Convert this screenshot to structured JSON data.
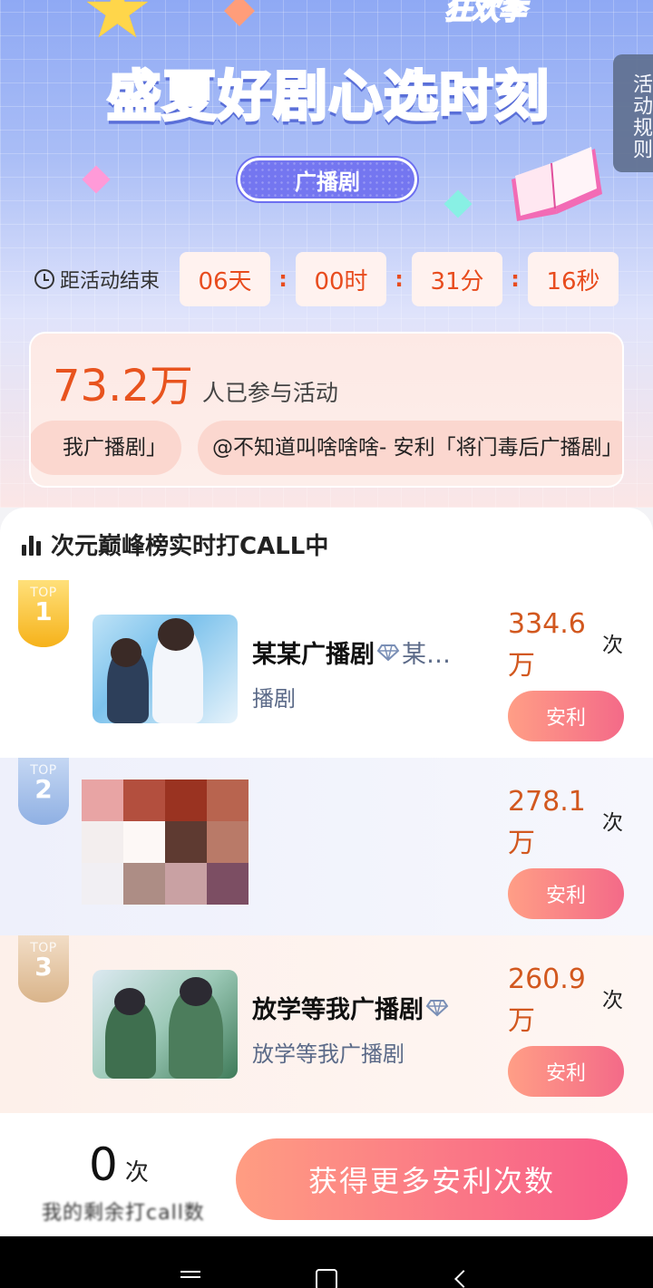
{
  "header": {
    "brand_text": "狂欢季",
    "title_part1": "盛夏好剧",
    "title_part2": "心选时刻",
    "rules_tab_label": "活动规则",
    "category_label": "广播剧"
  },
  "countdown": {
    "label": "距活动结束",
    "days": "06天",
    "hours": "00时",
    "minutes": "31分",
    "seconds": "16秒",
    "separator": ":"
  },
  "participation": {
    "count": "73.2万",
    "text": "人已参与活动",
    "marquee": [
      "我广播剧」",
      "@不知道叫啥啥啥- 安利「将门毒后广播剧」"
    ]
  },
  "ranking": {
    "title": "次元巅峰榜实时打CALL中",
    "medal_prefix": "TOP",
    "times_unit": "次",
    "recommend_label": "安利",
    "items": [
      {
        "rank": "1",
        "name": "某某广播剧",
        "name_suffix": "某…",
        "subtitle": "播剧",
        "score": "334.6万"
      },
      {
        "rank": "2",
        "name": "",
        "name_suffix": "",
        "subtitle": "",
        "score": "278.1万"
      },
      {
        "rank": "3",
        "name": "放学等我广播剧",
        "name_suffix": "",
        "subtitle": "放学等我广播剧",
        "score": "260.9万"
      }
    ]
  },
  "bottom": {
    "my_count": "0",
    "my_unit": "次",
    "my_label": "我的剩余打call数",
    "cta_label": "获得更多安利次数"
  },
  "colors": {
    "accent_orange": "#e8531e",
    "button_gradient_start": "#ff9d82",
    "button_gradient_end": "#f75a89",
    "category_pill": "#7476f0"
  },
  "icons": {
    "countdown": "clock-icon",
    "ranking_title": "bar-chart-icon",
    "vip": "diamond-icon"
  }
}
